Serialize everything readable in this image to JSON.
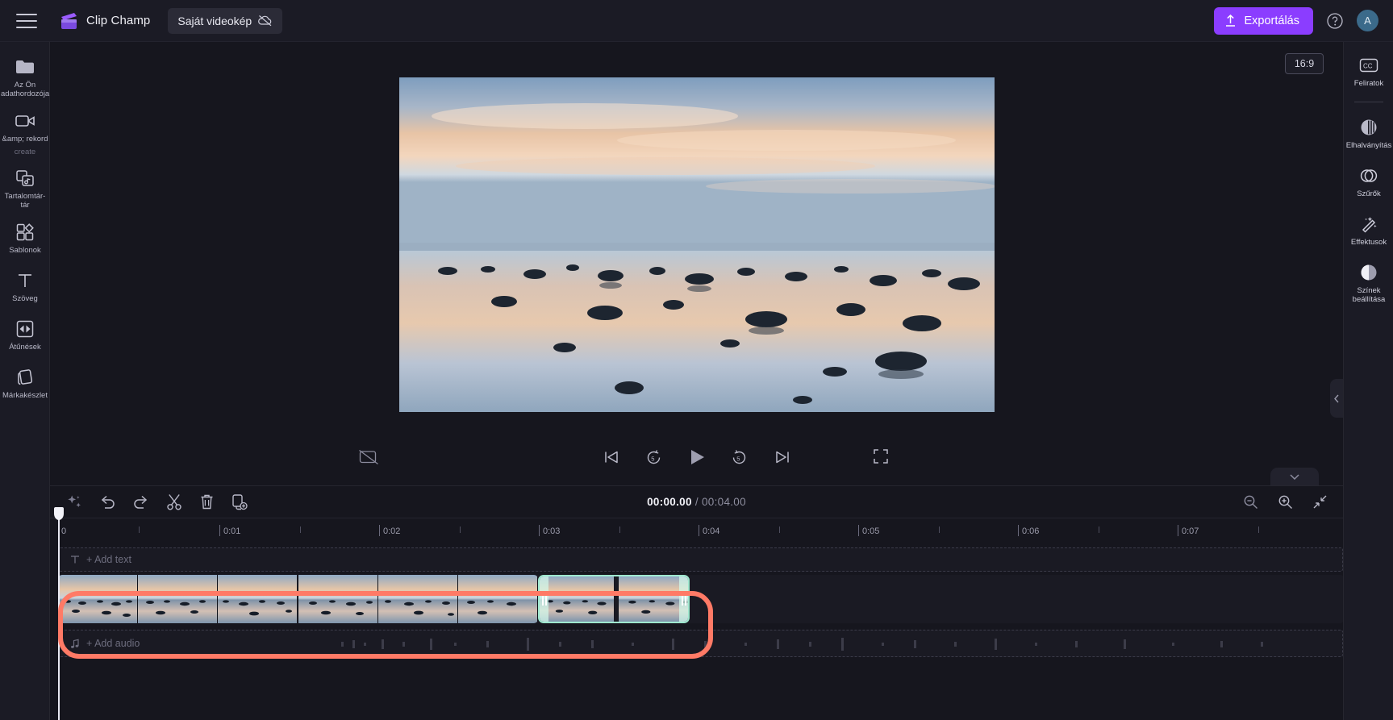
{
  "topbar": {
    "menu_icon": "hamburger-menu-icon",
    "brand_name": "Clip Champ",
    "project_name": "Saját videokép",
    "cloud_icon": "cloud-off-icon",
    "export_label": "Exportálás",
    "export_icon": "upload-icon",
    "help_icon": "help-circle-icon",
    "avatar_initial": "A",
    "accent_color": "#8b3dff"
  },
  "left_rail": [
    {
      "icon": "media-folder-icon",
      "label": "Az Ön adathordozója",
      "sub": ""
    },
    {
      "icon": "video-camera-icon",
      "label": "&amp; rekord",
      "sub": "create"
    },
    {
      "icon": "content-library-icon",
      "label": "Tartalomtár-tár",
      "sub": ""
    },
    {
      "icon": "templates-grid-icon",
      "label": "Sablonok",
      "sub": ""
    },
    {
      "icon": "text-t-icon",
      "label": "Szöveg",
      "sub": ""
    },
    {
      "icon": "transitions-icon",
      "label": "Átűnések",
      "sub": ""
    },
    {
      "icon": "brand-kit-icon",
      "label": "Márkakészlet",
      "sub": ""
    }
  ],
  "right_rail": [
    {
      "icon": "closed-captions-icon",
      "label": "Feliratok"
    },
    {
      "icon": "fade-icon",
      "label": "Elhalványítás"
    },
    {
      "icon": "filters-icon",
      "label": "Szűrők"
    },
    {
      "icon": "effects-wand-icon",
      "label": "Effektusok"
    },
    {
      "icon": "color-adjust-icon",
      "label": "Színek beállítása"
    }
  ],
  "stage": {
    "aspect_ratio": "16:9",
    "captions_icon": "captions-off-icon",
    "fullscreen_icon": "fullscreen-icon",
    "collapse_icon": "chevron-down-icon",
    "panel_collapse_icon": "chevron-left-icon",
    "transport": [
      {
        "icon": "skip-to-start-icon",
        "name": "skip-start-button"
      },
      {
        "icon": "rewind-5s-icon",
        "name": "rewind-button"
      },
      {
        "icon": "play-icon",
        "name": "play-button"
      },
      {
        "icon": "forward-5s-icon",
        "name": "forward-button"
      },
      {
        "icon": "skip-to-end-icon",
        "name": "skip-end-button"
      }
    ]
  },
  "timeline": {
    "tools": [
      {
        "icon": "magic-sparkle-icon",
        "name": "ai-tools-button"
      },
      {
        "icon": "undo-icon",
        "name": "undo-button"
      },
      {
        "icon": "redo-icon",
        "name": "redo-button"
      },
      {
        "icon": "scissors-icon",
        "name": "split-button"
      },
      {
        "icon": "trash-icon",
        "name": "delete-button"
      },
      {
        "icon": "duplicate-icon",
        "name": "duplicate-button"
      }
    ],
    "current_time": "00:00.00",
    "separator": "/",
    "total_time": "00:04.00",
    "zoom_controls": [
      {
        "icon": "zoom-out-icon",
        "name": "zoom-out-button"
      },
      {
        "icon": "zoom-in-icon",
        "name": "zoom-in-button"
      },
      {
        "icon": "fit-to-screen-icon",
        "name": "fit-timeline-button"
      }
    ],
    "ruler_labels": [
      "0",
      "0:01",
      "0:02",
      "0:03",
      "0:04",
      "0:05",
      "0:06",
      "0:07"
    ],
    "text_track_hint": "+ Add text",
    "text_track_icon": "text-t-icon",
    "audio_track_hint": "+ Add audio",
    "audio_track_icon": "music-note-icon",
    "selected_clip_border_color": "#9fe8cf",
    "annotation_color": "#ff7a66",
    "playhead_position": "0"
  }
}
